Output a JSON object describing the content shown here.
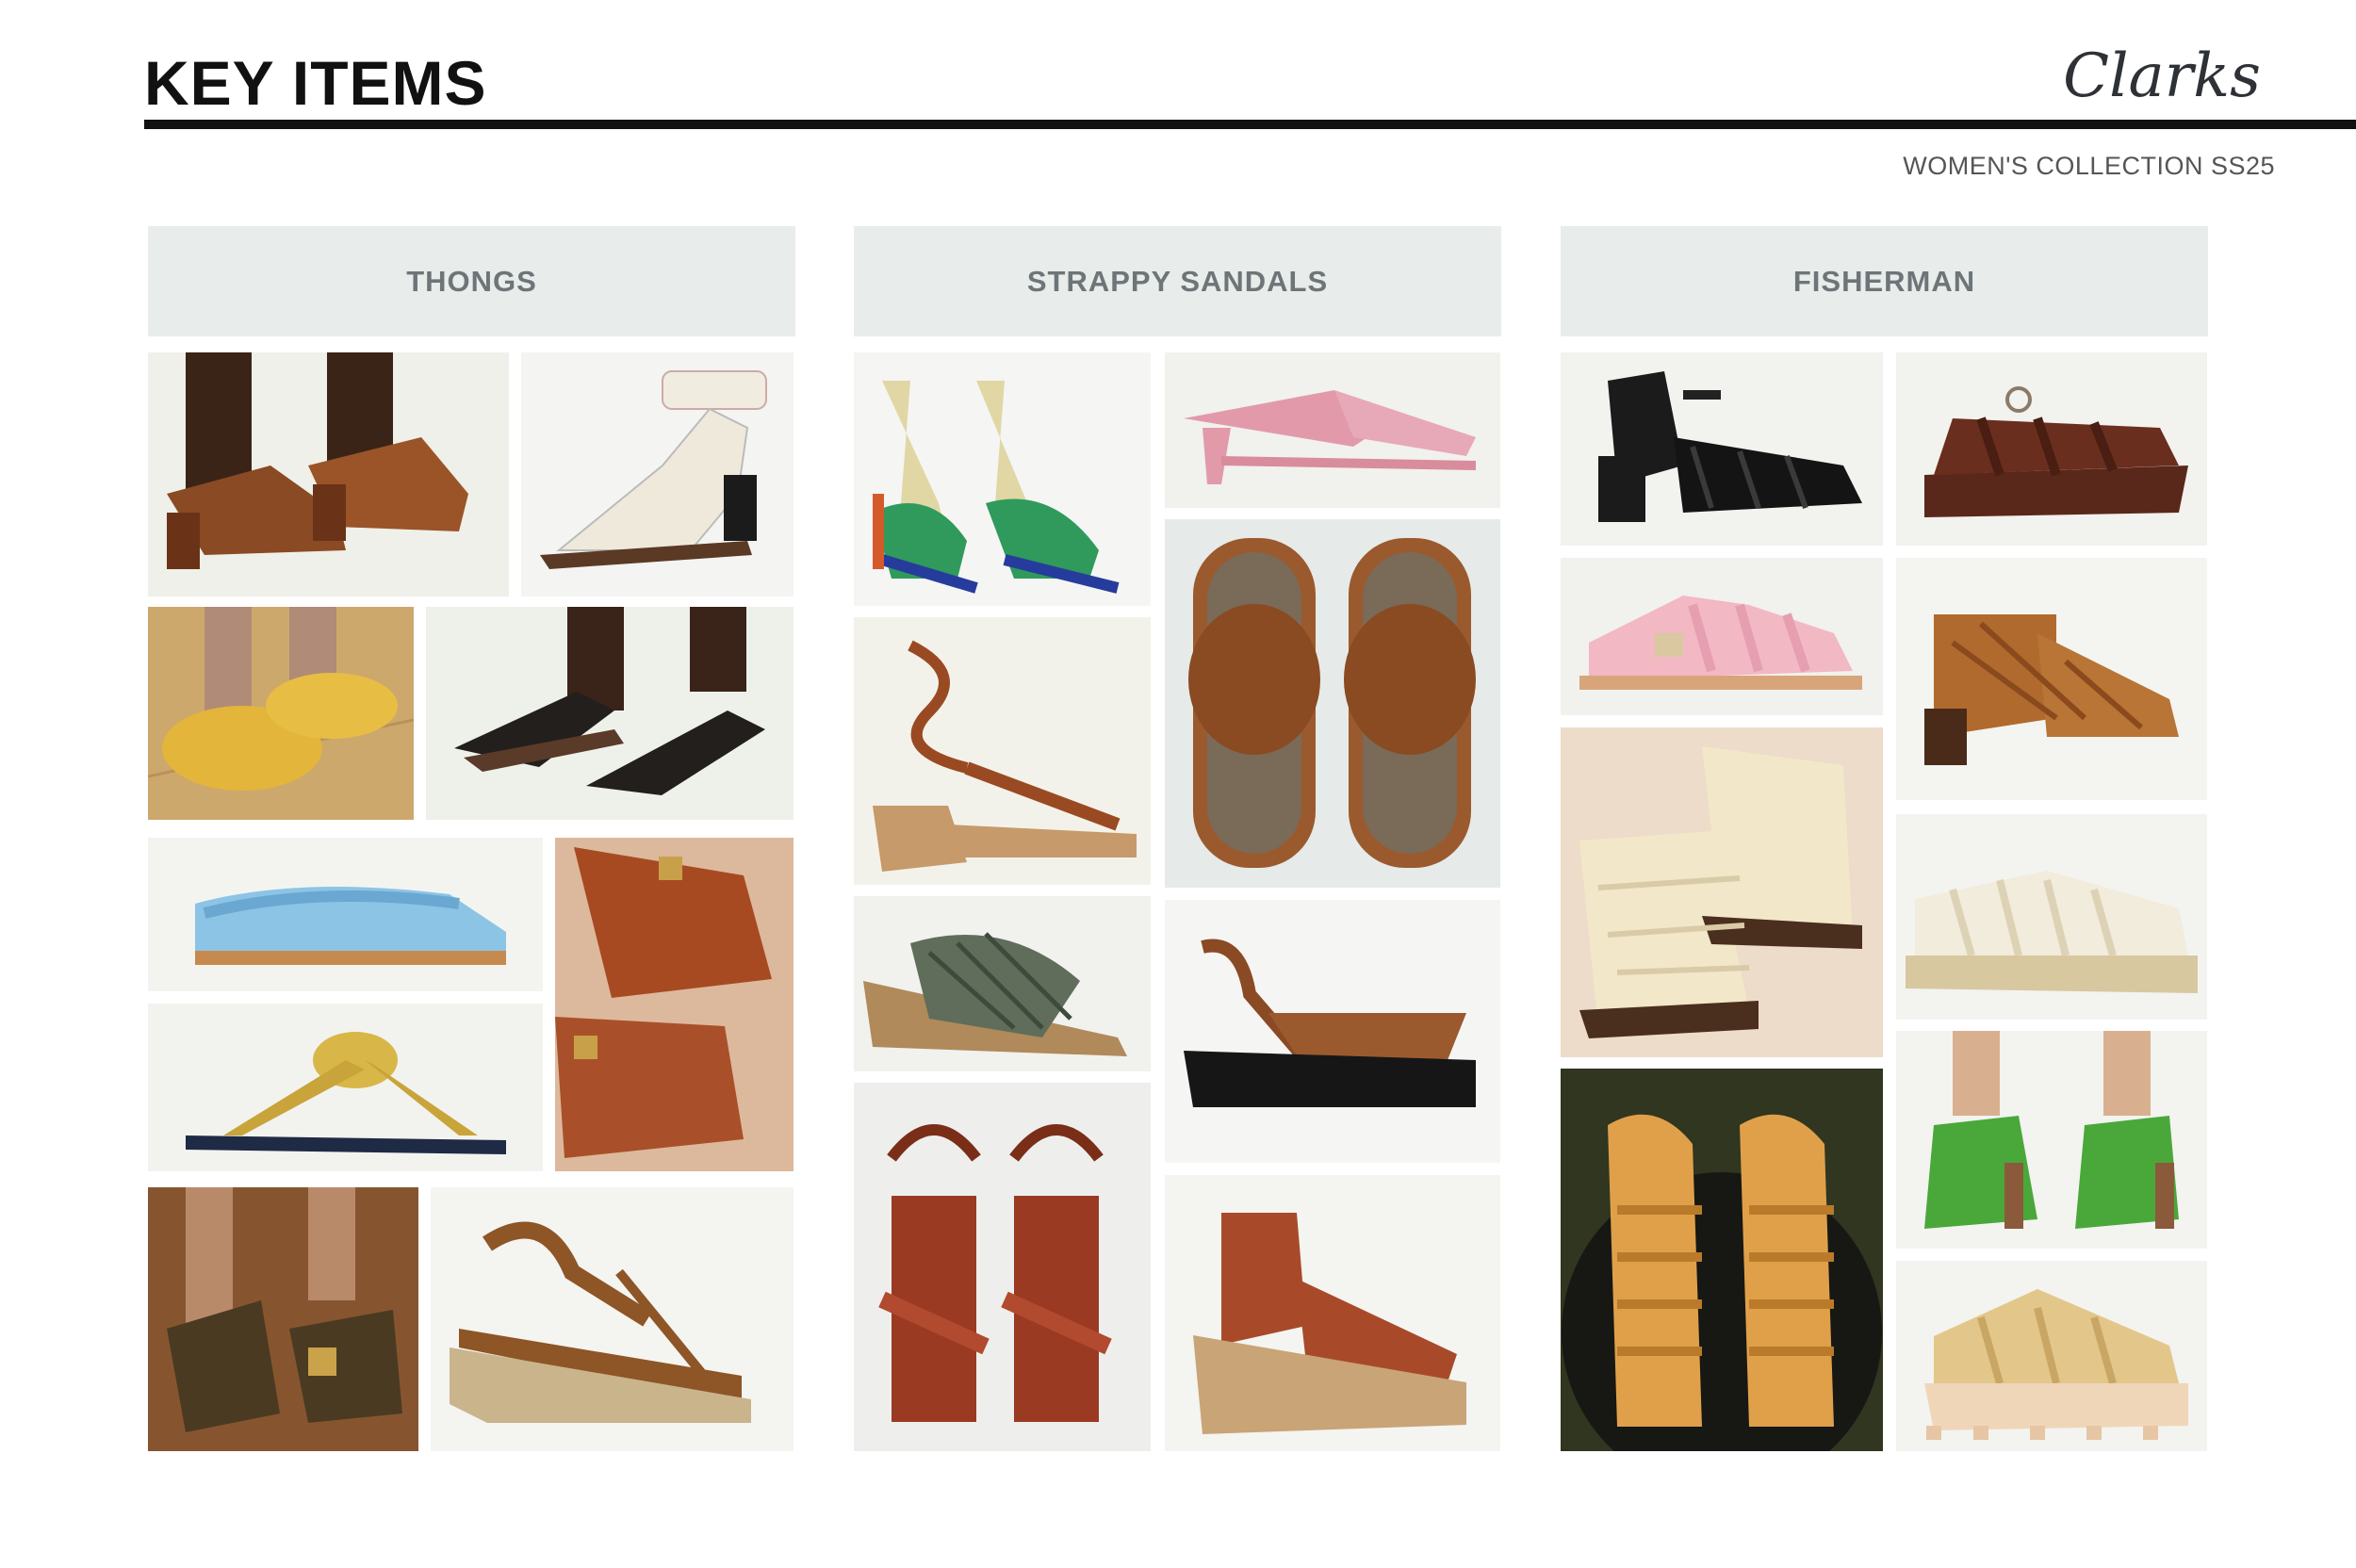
{
  "page": {
    "title": "KEY ITEMS",
    "brand": "Clarks",
    "subtitle": "WOMEN'S COLLECTION SS25"
  },
  "columns": [
    {
      "heading": "THONGS"
    },
    {
      "heading": "STRAPPY SANDALS"
    },
    {
      "heading": "FISHERMAN"
    }
  ],
  "colors": {
    "header_band": "#e8ecea",
    "header_text": "#6e7578",
    "rule": "#111111"
  }
}
